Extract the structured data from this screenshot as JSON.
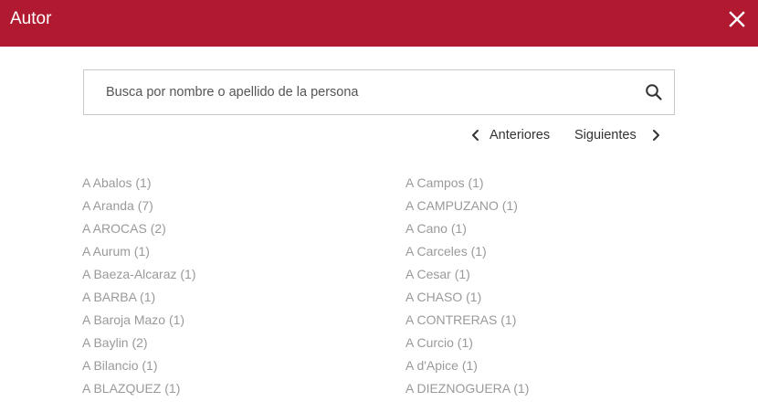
{
  "dialog": {
    "title": "Autor",
    "accent_color": "#b0192f",
    "close_icon": "close-icon"
  },
  "search": {
    "value": "",
    "placeholder": "Busca por nombre o apellido de la persona",
    "icon": "search-icon"
  },
  "pagination": {
    "prev_label": "Anteriores",
    "next_label": "Siguientes"
  },
  "authors_left": [
    "A Abalos (1)",
    "A Aranda (7)",
    "A AROCAS (2)",
    "A Aurum (1)",
    "A Baeza-Alcaraz (1)",
    "A BARBA (1)",
    "A Baroja Mazo (1)",
    "A Baylin (2)",
    "A Bilancio (1)",
    "A BLAZQUEZ (1)"
  ],
  "authors_right": [
    "A Campos (1)",
    "A CAMPUZANO (1)",
    "A Cano (1)",
    "A Carceles (1)",
    "A Cesar (1)",
    "A CHASO (1)",
    "A CONTRERAS (1)",
    "A Curcio (1)",
    "A d'Apice (1)",
    "A DIEZNOGUERA (1)"
  ]
}
